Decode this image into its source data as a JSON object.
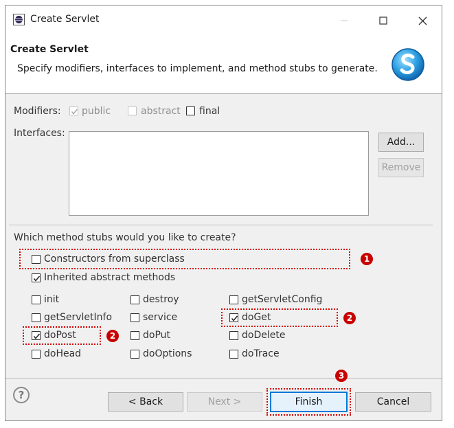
{
  "window": {
    "title": "Create Servlet"
  },
  "header": {
    "title": "Create Servlet",
    "description": "Specify modifiers, interfaces to implement, and method stubs to generate."
  },
  "modifiers": {
    "label": "Modifiers:",
    "public": "public",
    "abstract": "abstract",
    "final": "final"
  },
  "interfaces": {
    "label": "Interfaces:",
    "add": "Add...",
    "remove": "Remove"
  },
  "stubs": {
    "question": "Which method stubs would you like to create?",
    "constructors": "Constructors from superclass",
    "inherited": "Inherited abstract methods",
    "methods": {
      "init": "init",
      "destroy": "destroy",
      "getServletConfig": "getServletConfig",
      "getServletInfo": "getServletInfo",
      "service": "service",
      "doGet": "doGet",
      "doPost": "doPost",
      "doPut": "doPut",
      "doDelete": "doDelete",
      "doHead": "doHead",
      "doOptions": "doOptions",
      "doTrace": "doTrace"
    }
  },
  "footer": {
    "help": "?",
    "back": "< Back",
    "next": "Next >",
    "finish": "Finish",
    "cancel": "Cancel"
  },
  "annotations": {
    "one": "1",
    "two": "2",
    "three": "3"
  },
  "colors": {
    "annotation": "#c80000",
    "primary_border": "#0078d7"
  }
}
